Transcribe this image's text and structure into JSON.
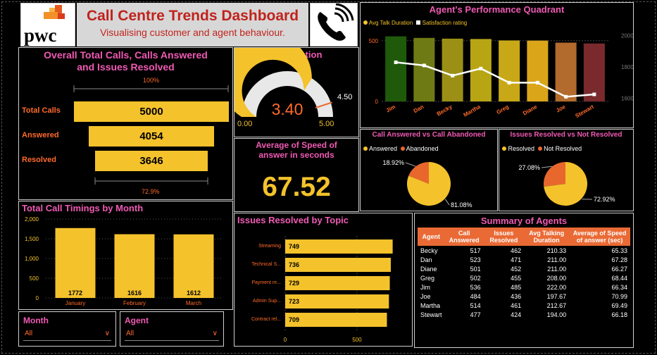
{
  "header": {
    "logo_text": "pwc",
    "title": "Call Centre Trends Dashboard",
    "subtitle": "Visualising customer and agent behaviour.",
    "phone_icon": "phone-icon"
  },
  "totals": {
    "title_line1": "Overall Total Calls, Calls Answered",
    "title_line2": "and Issues Resolved",
    "top_pct": "100%",
    "bottom_pct": "72.9%",
    "rows": [
      {
        "label": "Total Calls",
        "value": 5000
      },
      {
        "label": "Answered",
        "value": 4054
      },
      {
        "label": "Resolved",
        "value": 3646
      }
    ]
  },
  "satisfaction": {
    "title": "Overall Satisfaction",
    "value": "3.40",
    "target": "4.50",
    "min": "0.00",
    "max": "5.00",
    "value_num": 3.4,
    "target_num": 4.5,
    "max_num": 5
  },
  "speed": {
    "title_line1": "Average of Speed of",
    "title_line2": "answer in seconds",
    "value": "67.52"
  },
  "monthly": {
    "title": "Total Call Timings by Month",
    "chart_data": {
      "type": "bar",
      "categories": [
        "January",
        "February",
        "March"
      ],
      "values": [
        1772,
        1616,
        1612
      ],
      "yticks": [
        "0",
        "500",
        "1,000",
        "1,500",
        "2,000"
      ],
      "ylim": [
        0,
        2000
      ]
    }
  },
  "slicers": {
    "month": {
      "label": "Month",
      "value": "All"
    },
    "agent": {
      "label": "Agent",
      "value": "All"
    }
  },
  "quadrant": {
    "title": "Agent's Performance Quadrant",
    "legend": [
      "Avg Talk Duration",
      "Satisfaction rating"
    ],
    "chart_data": {
      "type": "bar+line",
      "categories": [
        "Jim",
        "Dan",
        "Becky",
        "Martha",
        "Greg",
        "Diane",
        "Joe",
        "Stewart"
      ],
      "bar_values": [
        536,
        523,
        517,
        514,
        502,
        501,
        484,
        477
      ],
      "line_values": [
        1830,
        1810,
        1745,
        1790,
        1700,
        1700,
        1610,
        1625
      ],
      "left_ticks": [
        "0",
        "500"
      ],
      "right_ticks": [
        "1600",
        "1800",
        "2000"
      ],
      "left_lim": [
        0,
        580
      ],
      "right_lim": [
        1580,
        2030
      ],
      "bar_colors": [
        "#1f5a0a",
        "#6e7b14",
        "#9b9015",
        "#b7a514",
        "#c8a817",
        "#dba51a",
        "#b26b2c",
        "#7a2a2d"
      ]
    }
  },
  "answered_pie": {
    "title": "Call Answered vs Call Abandoned",
    "legend": [
      "Answered",
      "Abandoned"
    ],
    "chart_data": {
      "type": "pie",
      "labels": [
        "Answered",
        "Abandoned"
      ],
      "values": [
        81.08,
        18.92
      ],
      "label_text": [
        "81.08%",
        "18.92%"
      ],
      "colors": [
        "#f4c22b",
        "#e8672d"
      ]
    }
  },
  "resolved_pie": {
    "title": "Issues Resolved vs Not Resolved",
    "legend": [
      "Resolved",
      "Not Resolved"
    ],
    "chart_data": {
      "type": "pie",
      "labels": [
        "Resolved",
        "Not Resolved"
      ],
      "values": [
        72.92,
        27.08
      ],
      "label_text": [
        "72.92%",
        "27.08%"
      ],
      "colors": [
        "#f4c22b",
        "#e8672d"
      ]
    }
  },
  "topics": {
    "title": "Issues Resolved by Topic",
    "chart_data": {
      "type": "bar",
      "categories": [
        "Streaming",
        "Technical S...",
        "Payment re...",
        "Admin Sup...",
        "Contract rel..."
      ],
      "values": [
        749,
        736,
        729,
        723,
        709
      ],
      "xticks": [
        "0",
        "500"
      ],
      "xlim": [
        0,
        800
      ]
    }
  },
  "summary": {
    "title": "Summary of Agents",
    "columns": [
      "Agent",
      "Call Answered",
      "Issues Resolved",
      "Avg Talking Duration",
      "Average of Speed of answer (sec)"
    ],
    "rows": [
      [
        "Becky",
        "517",
        "462",
        "210.33",
        "65.33"
      ],
      [
        "Dan",
        "523",
        "471",
        "211.00",
        "67.28"
      ],
      [
        "Diane",
        "501",
        "452",
        "211.00",
        "66.27"
      ],
      [
        "Greg",
        "502",
        "455",
        "208.00",
        "68.44"
      ],
      [
        "Jim",
        "536",
        "485",
        "222.00",
        "66.34"
      ],
      [
        "Joe",
        "484",
        "436",
        "197.67",
        "70.99"
      ],
      [
        "Martha",
        "514",
        "461",
        "212.67",
        "69.49"
      ],
      [
        "Stewart",
        "477",
        "424",
        "194.00",
        "66.18"
      ]
    ]
  }
}
